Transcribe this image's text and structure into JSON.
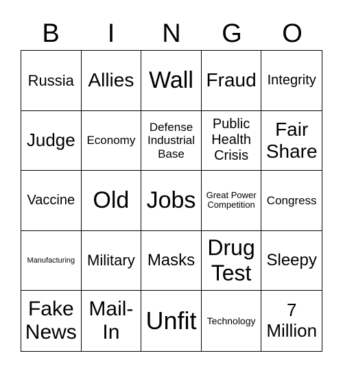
{
  "header": {
    "letters": [
      "B",
      "I",
      "N",
      "G",
      "O"
    ]
  },
  "cells": [
    "Russia",
    "Allies",
    "Wall",
    "Fraud",
    "Integrity",
    "Judge",
    "Economy",
    "Defense Industrial Base",
    "Public Health Crisis",
    "Fair Share",
    "Vaccine",
    "Old",
    "Jobs",
    "Great Power Competition",
    "Congress",
    "Manufacturing",
    "Military",
    "Masks",
    "Drug Test",
    "Sleepy",
    "Fake News",
    "Mail-In",
    "Unfit",
    "Technology",
    "7 Million"
  ]
}
